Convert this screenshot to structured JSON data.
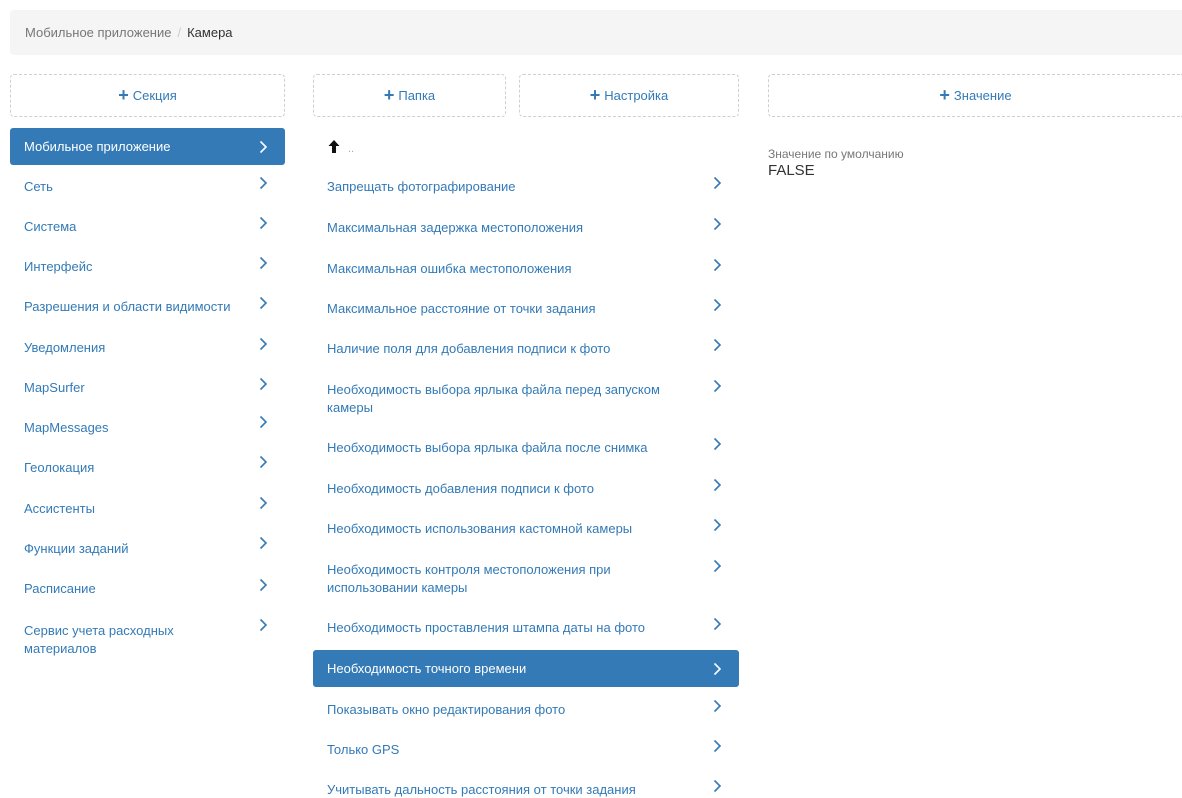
{
  "breadcrumb": {
    "parent": "Мобильное приложение",
    "separator": "/",
    "current": "Камера"
  },
  "buttons": {
    "add_section": "Секция",
    "add_folder": "Папка",
    "add_setting": "Настройка",
    "add_value": "Значение"
  },
  "sections": [
    {
      "label": "Мобильное приложение",
      "active": true
    },
    {
      "label": "Сеть"
    },
    {
      "label": "Система"
    },
    {
      "label": "Интерфейс"
    },
    {
      "label": "Разрешения и области видимости"
    },
    {
      "label": "Уведомления"
    },
    {
      "label": "MapSurfer"
    },
    {
      "label": "MapMessages"
    },
    {
      "label": "Геолокация"
    },
    {
      "label": "Ассистенты"
    },
    {
      "label": "Функции заданий"
    },
    {
      "label": "Расписание"
    },
    {
      "label": "Сервис учета расходных материалов"
    }
  ],
  "settings": {
    "up_label": "..",
    "items": [
      {
        "label": "Запрещать фотографирование"
      },
      {
        "label": "Максимальная задержка местоположения"
      },
      {
        "label": "Максимальная ошибка местоположения"
      },
      {
        "label": "Максимальное расстояние от точки задания"
      },
      {
        "label": "Наличие поля для добавления подписи к фото"
      },
      {
        "label": "Необходимость выбора ярлыка файла перед запуском камеры"
      },
      {
        "label": "Необходимость выбора ярлыка файла после снимка"
      },
      {
        "label": "Необходимость добавления подписи к фото"
      },
      {
        "label": "Необходимость использования кастомной камеры"
      },
      {
        "label": "Необходимость контроля местоположения при использовании камеры"
      },
      {
        "label": "Необходимость проставления штампа даты на фото"
      },
      {
        "label": "Необходимость точного времени",
        "active": true
      },
      {
        "label": "Показывать окно редактирования фото"
      },
      {
        "label": "Только GPS"
      },
      {
        "label": "Учитывать дальность расстояния от точки задания"
      }
    ]
  },
  "value": {
    "default_label": "Значение по умолчанию",
    "default_value": "FALSE"
  },
  "colors": {
    "accent": "#337ab7",
    "breadcrumb_bg": "#f5f5f5"
  }
}
